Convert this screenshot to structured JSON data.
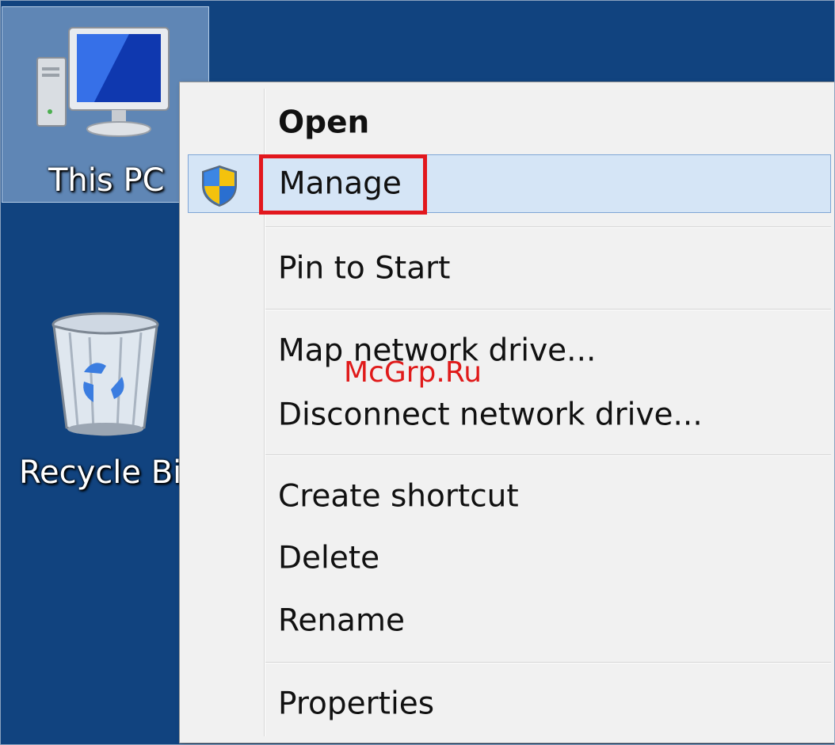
{
  "desktop": {
    "icons": [
      {
        "label": "This PC"
      },
      {
        "label": "Recycle Bin"
      }
    ]
  },
  "context_menu": {
    "items": [
      {
        "label": "Open"
      },
      {
        "label": "Manage"
      },
      {
        "label": "Pin to Start"
      },
      {
        "label": "Map network drive..."
      },
      {
        "label": "Disconnect network drive..."
      },
      {
        "label": "Create shortcut"
      },
      {
        "label": "Delete"
      },
      {
        "label": "Rename"
      },
      {
        "label": "Properties"
      }
    ],
    "highlighted_item": "Manage",
    "hover_color": "#d5e5f6",
    "highlight_box_color": "#e2171d"
  },
  "watermark": "McGrp.Ru",
  "colors": {
    "desktop_background": "#11437f",
    "menu_background": "#f1f1f1"
  }
}
